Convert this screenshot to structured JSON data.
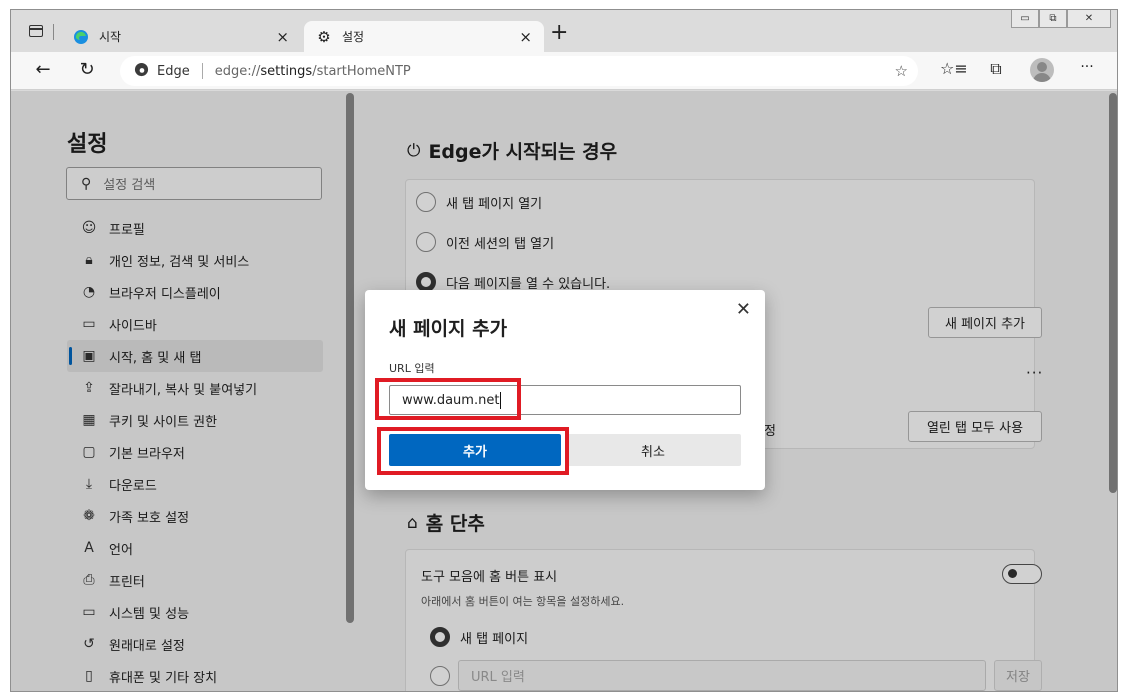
{
  "tabs": [
    {
      "title": "시작",
      "close": "×"
    },
    {
      "title": "설정",
      "close": "×"
    }
  ],
  "new_tab": "+",
  "window_controls": {
    "minimize": "▭",
    "restore": "⧉",
    "close": "✕"
  },
  "toolbar": {
    "back": "←",
    "refresh": "↻",
    "address": {
      "site": "Edge",
      "prefix": "edge://",
      "path_bold": "settings",
      "path_rest": "/startHomeNTP"
    },
    "favorites": "☆",
    "collections": "⧉",
    "more": "···"
  },
  "sidebar": {
    "title": "설정",
    "search_placeholder": "설정 검색",
    "items": [
      {
        "label": "프로필",
        "icon": "profile-icon",
        "glyph": "☺"
      },
      {
        "label": "개인 정보, 검색 및 서비스",
        "icon": "lock-icon",
        "glyph": "🔒︎"
      },
      {
        "label": "브라우저 디스플레이",
        "icon": "palette-icon",
        "glyph": "◔"
      },
      {
        "label": "사이드바",
        "icon": "sidebar-icon",
        "glyph": "▭"
      },
      {
        "label": "시작, 홈 및 새 탭",
        "icon": "home-tab-icon",
        "glyph": "▣",
        "selected": true
      },
      {
        "label": "잘라내기, 복사 및 붙여넣기",
        "icon": "share-icon",
        "glyph": "⇪"
      },
      {
        "label": "쿠키 및 사이트 권한",
        "icon": "cookie-icon",
        "glyph": "▦"
      },
      {
        "label": "기본 브라우저",
        "icon": "default-browser-icon",
        "glyph": "▢"
      },
      {
        "label": "다운로드",
        "icon": "download-icon",
        "glyph": "⤓"
      },
      {
        "label": "가족 보호 설정",
        "icon": "family-icon",
        "glyph": "❁"
      },
      {
        "label": "언어",
        "icon": "language-icon",
        "glyph": "A"
      },
      {
        "label": "프린터",
        "icon": "printer-icon",
        "glyph": "⎙"
      },
      {
        "label": "시스템 및 성능",
        "icon": "system-icon",
        "glyph": "▭"
      },
      {
        "label": "원래대로 설정",
        "icon": "reset-icon",
        "glyph": "↺"
      },
      {
        "label": "휴대폰 및 기타 장치",
        "icon": "phone-icon",
        "glyph": "▯"
      }
    ]
  },
  "startup_section": {
    "title": "Edge가 시작되는 경우",
    "options": [
      {
        "label": "새 탭 페이지 열기",
        "checked": false
      },
      {
        "label": "이전 세션의 탭 열기",
        "checked": false
      },
      {
        "label": "다음 페이지를 열 수 있습니다.",
        "checked": true
      }
    ],
    "add_page_button": "새 페이지 추가",
    "more": "···",
    "partial_text": "정",
    "use_open_tabs_button": "열린 탭 모두 사용"
  },
  "home_section": {
    "title": "홈 단추",
    "show_home_label": "도구 모음에 홈 버튼 표시",
    "show_home_desc": "아래에서 홈 버튼이 여는 항목을 설정하세요.",
    "toggle_on": false,
    "new_tab_option": "새 탭 페이지",
    "url_placeholder": "URL 입력",
    "save_button": "저장"
  },
  "dialog": {
    "title": "새 페이지 추가",
    "close": "✕",
    "url_label": "URL 입력",
    "url_value": "www.daum.net",
    "add_button": "추가",
    "cancel_button": "취소"
  },
  "colors": {
    "accent": "#0067c0",
    "highlight": "#e01b24"
  }
}
